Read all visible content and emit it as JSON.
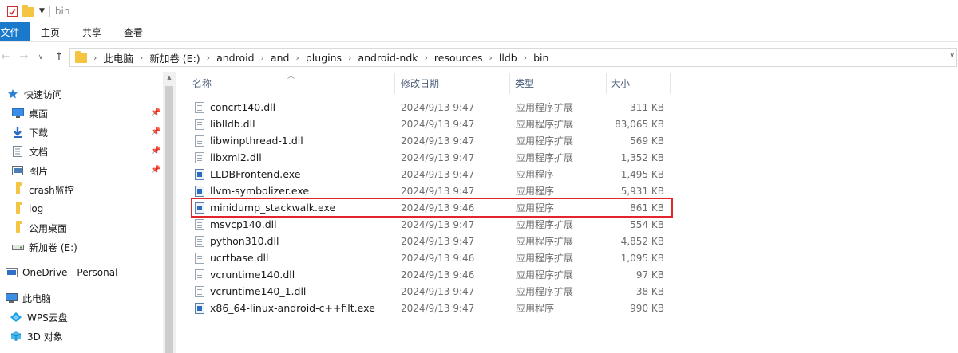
{
  "window": {
    "title": "bin"
  },
  "ribbon": {
    "tabs": [
      "文件",
      "主页",
      "共享",
      "查看"
    ]
  },
  "address": {
    "crumbs": [
      "此电脑",
      "新加卷 (E:)",
      "android",
      "and",
      "plugins",
      "android-ndk",
      "resources",
      "lldb",
      "bin"
    ]
  },
  "sidebar": {
    "items": [
      {
        "label": "快速访问",
        "icon": "star-icon",
        "pinned": false
      },
      {
        "label": "桌面",
        "icon": "desktop-icon",
        "pinned": true
      },
      {
        "label": "下载",
        "icon": "download-icon",
        "pinned": true
      },
      {
        "label": "文档",
        "icon": "document-icon",
        "pinned": true
      },
      {
        "label": "图片",
        "icon": "picture-icon",
        "pinned": true
      },
      {
        "label": "crash监控",
        "icon": "folder-icon",
        "pinned": false
      },
      {
        "label": "log",
        "icon": "folder-icon",
        "pinned": false
      },
      {
        "label": "公用桌面",
        "icon": "folder-icon",
        "pinned": false
      },
      {
        "label": "新加卷 (E:)",
        "icon": "drive-icon",
        "pinned": false
      },
      {
        "label": "OneDrive - Personal",
        "icon": "cloud-icon",
        "pinned": false
      },
      {
        "label": "此电脑",
        "icon": "computer-icon",
        "pinned": false
      },
      {
        "label": "WPS云盘",
        "icon": "cloud-icon",
        "pinned": false
      },
      {
        "label": "3D 对象",
        "icon": "cube-icon",
        "pinned": false
      }
    ]
  },
  "columns": {
    "name": "名称",
    "date": "修改日期",
    "type": "类型",
    "size": "大小"
  },
  "files": [
    {
      "name": "concrt140.dll",
      "date": "2024/9/13 9:47",
      "type": "应用程序扩展",
      "size": "311 KB",
      "kind": "dll"
    },
    {
      "name": "liblldb.dll",
      "date": "2024/9/13 9:47",
      "type": "应用程序扩展",
      "size": "83,065 KB",
      "kind": "dll"
    },
    {
      "name": "libwinpthread-1.dll",
      "date": "2024/9/13 9:47",
      "type": "应用程序扩展",
      "size": "569 KB",
      "kind": "dll"
    },
    {
      "name": "libxml2.dll",
      "date": "2024/9/13 9:47",
      "type": "应用程序扩展",
      "size": "1,352 KB",
      "kind": "dll"
    },
    {
      "name": "LLDBFrontend.exe",
      "date": "2024/9/13 9:47",
      "type": "应用程序",
      "size": "1,495 KB",
      "kind": "exe"
    },
    {
      "name": "llvm-symbolizer.exe",
      "date": "2024/9/13 9:47",
      "type": "应用程序",
      "size": "5,931 KB",
      "kind": "exe"
    },
    {
      "name": "minidump_stackwalk.exe",
      "date": "2024/9/13 9:46",
      "type": "应用程序",
      "size": "861 KB",
      "kind": "exe"
    },
    {
      "name": "msvcp140.dll",
      "date": "2024/9/13 9:47",
      "type": "应用程序扩展",
      "size": "554 KB",
      "kind": "dll"
    },
    {
      "name": "python310.dll",
      "date": "2024/9/13 9:47",
      "type": "应用程序扩展",
      "size": "4,852 KB",
      "kind": "dll"
    },
    {
      "name": "ucrtbase.dll",
      "date": "2024/9/13 9:46",
      "type": "应用程序扩展",
      "size": "1,095 KB",
      "kind": "dll"
    },
    {
      "name": "vcruntime140.dll",
      "date": "2024/9/13 9:46",
      "type": "应用程序扩展",
      "size": "97 KB",
      "kind": "dll"
    },
    {
      "name": "vcruntime140_1.dll",
      "date": "2024/9/13 9:47",
      "type": "应用程序扩展",
      "size": "38 KB",
      "kind": "dll"
    },
    {
      "name": "x86_64-linux-android-c++filt.exe",
      "date": "2024/9/13 9:47",
      "type": "应用程序",
      "size": "990 KB",
      "kind": "exe"
    }
  ],
  "colors": {
    "accent": "#1979ca",
    "highlight": "#e3242b"
  }
}
